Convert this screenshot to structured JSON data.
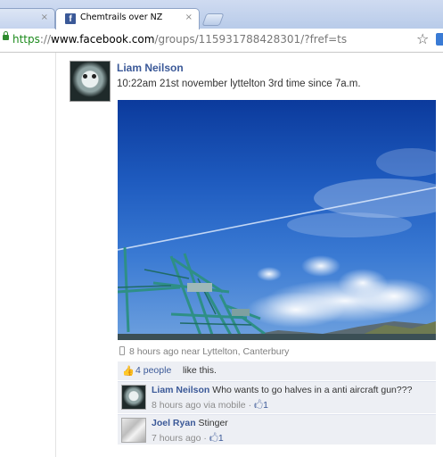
{
  "browser": {
    "active_tab_title": "Chemtrails over NZ",
    "url_scheme": "https",
    "url_sep": "://",
    "url_domain": "www.facebook.com",
    "url_path": "/groups/115931788428301/?fref=ts",
    "close_glyph": "×",
    "favicon_glyph": "f",
    "star_glyph": "☆"
  },
  "post": {
    "author": "Liam Neilson",
    "text": "10:22am 21st november lyttelton 3rd time since 7a.m.",
    "meta": "8 hours ago near Lyttelton, Canterbury"
  },
  "likes": {
    "count_label": "4 people",
    "suffix": "like this.",
    "icon_glyph": "👍"
  },
  "comments": [
    {
      "author": "Liam Neilson",
      "text": "Who wants to go halves in a anti aircraft gun???",
      "time": "8 hours ago via mobile",
      "likes": "1"
    },
    {
      "author": "Joel Ryan",
      "text": "Stinger",
      "time": "7 hours ago",
      "likes": "1"
    }
  ],
  "separator": " · ",
  "like_glyph": "🖒",
  "colors": {
    "fb_blue": "#3b5998",
    "ufi_bg": "#edeff4",
    "url_green": "#1c8a1c",
    "sky": "#1f5cc0"
  },
  "icons": [
    "lock-icon",
    "star-icon",
    "facebook-favicon",
    "phone-icon",
    "thumbs-up-icon",
    "close-icon"
  ]
}
